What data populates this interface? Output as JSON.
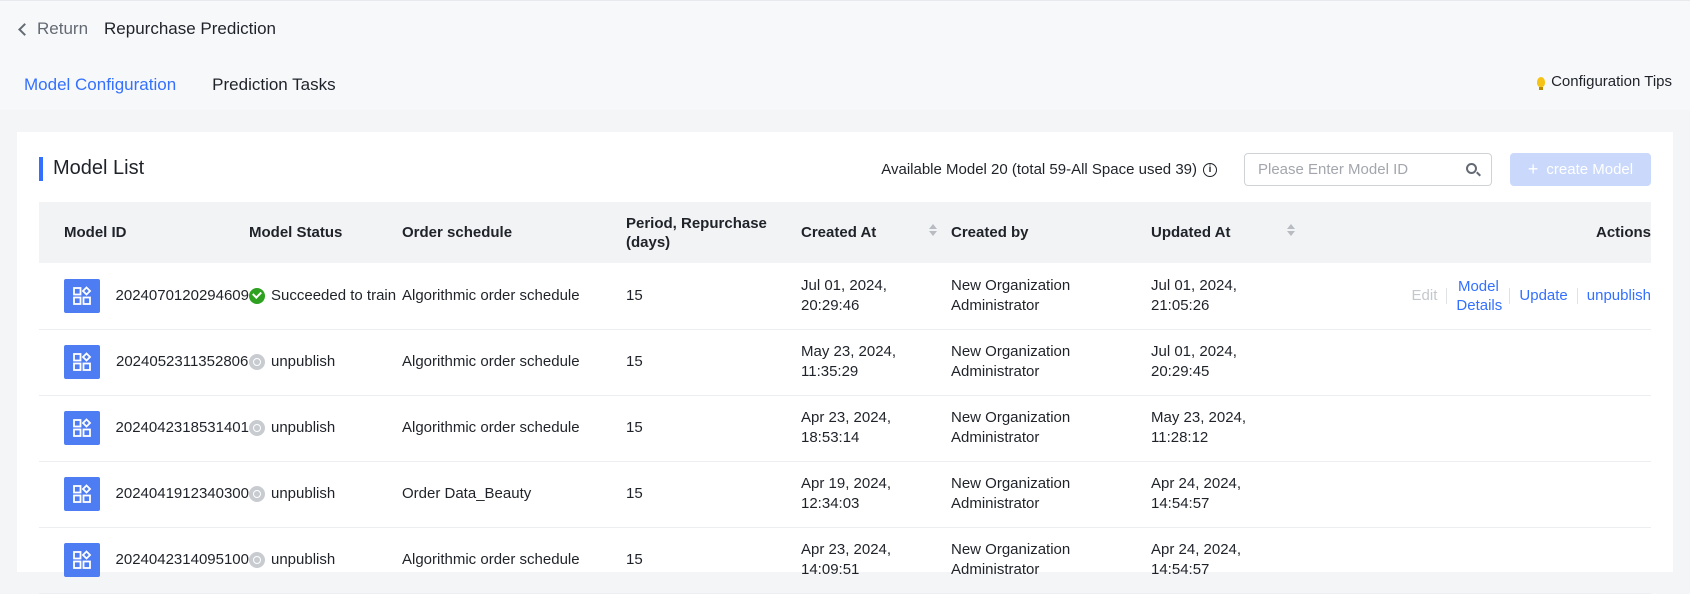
{
  "header": {
    "return_label": "Return",
    "page_title": "Repurchase Prediction",
    "tabs": [
      {
        "label": "Model Configuration",
        "active": true
      },
      {
        "label": "Prediction Tasks",
        "active": false
      }
    ],
    "tips_label": "Configuration Tips"
  },
  "list": {
    "title": "Model List",
    "available_text": "Available Model 20 (total 59-All Space used 39)",
    "search_placeholder": "Please Enter Model ID",
    "create_label": "create Model",
    "columns": {
      "model_id": "Model ID",
      "status": "Model Status",
      "order_schedule": "Order schedule",
      "period": "Period, Repurchase (days)",
      "created_at": "Created At",
      "created_by": "Created by",
      "updated_at": "Updated At",
      "actions": "Actions"
    },
    "rows": [
      {
        "id": "2024070120294609",
        "status": "Succeeded to train",
        "status_type": "success",
        "schedule": "Algorithmic order schedule",
        "period": "15",
        "created_at": "Jul 01, 2024, 20:29:46",
        "created_by": "New Organization Administrator",
        "updated_at": "Jul 01, 2024, 21:05:26",
        "actions": {
          "edit": "Edit",
          "details": "Model Details",
          "update": "Update",
          "unpublish": "unpublish"
        }
      },
      {
        "id": "2024052311352806",
        "status": "unpublish",
        "status_type": "unpublish",
        "schedule": "Algorithmic order schedule",
        "period": "15",
        "created_at": "May 23, 2024, 11:35:29",
        "created_by": "New Organization Administrator",
        "updated_at": "Jul 01, 2024, 20:29:45"
      },
      {
        "id": "2024042318531401",
        "status": "unpublish",
        "status_type": "unpublish",
        "schedule": "Algorithmic order schedule",
        "period": "15",
        "created_at": "Apr 23, 2024, 18:53:14",
        "created_by": "New Organization Administrator",
        "updated_at": "May 23, 2024, 11:28:12"
      },
      {
        "id": "2024041912340300",
        "status": "unpublish",
        "status_type": "unpublish",
        "schedule": "Order Data_Beauty",
        "period": "15",
        "created_at": "Apr 19, 2024, 12:34:03",
        "created_by": "New Organization Administrator",
        "updated_at": "Apr 24, 2024, 14:54:57"
      },
      {
        "id": "2024042314095100",
        "status": "unpublish",
        "status_type": "unpublish",
        "schedule": "Algorithmic order schedule",
        "period": "15",
        "created_at": "Apr 23, 2024, 14:09:51",
        "created_by": "New Organization Administrator",
        "updated_at": "Apr 24, 2024, 14:54:57"
      }
    ]
  },
  "colors": {
    "accent": "#3370ff",
    "success": "#2ea121",
    "icon_bg": "#4e7cf2",
    "disabled_button": "#c9d8fb"
  }
}
